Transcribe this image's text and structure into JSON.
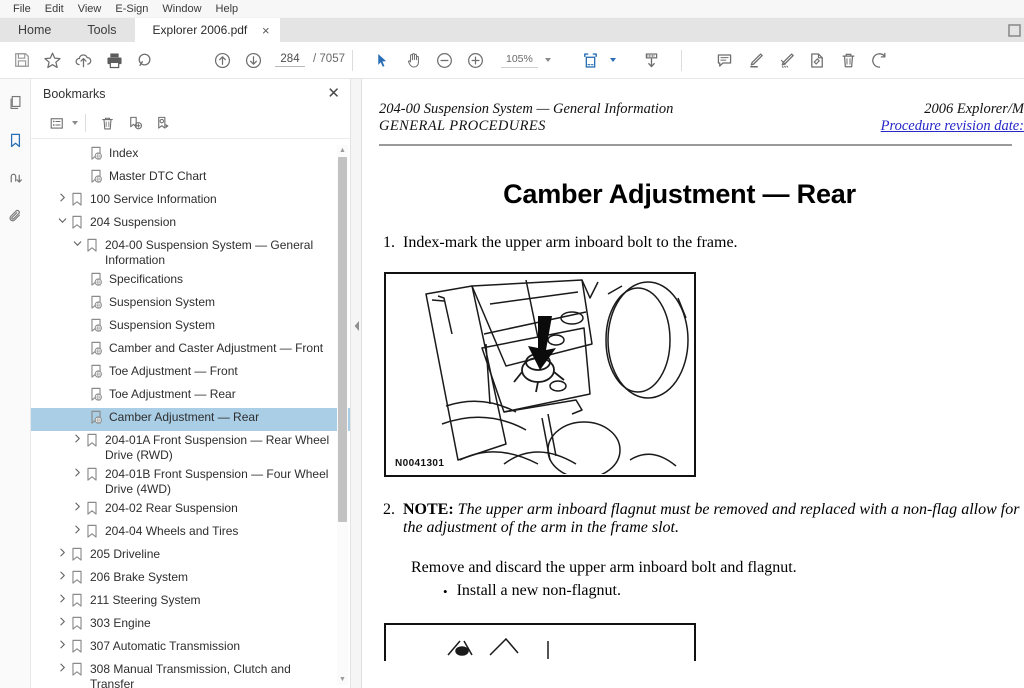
{
  "menubar": {
    "items": [
      "File",
      "Edit",
      "View",
      "E-Sign",
      "Window",
      "Help"
    ]
  },
  "tabbar": {
    "home_label": "Home",
    "tools_label": "Tools",
    "document_tab": "Explorer 2006.pdf",
    "close_glyph": "×"
  },
  "toolbar": {
    "save_icon": "save-icon",
    "star_icon": "star-icon",
    "cloud_upload_icon": "cloud-upload-icon",
    "print_icon": "print-icon",
    "search_icon": "search-icon",
    "prev_page_icon": "arrow-up-circle-icon",
    "next_page_icon": "arrow-down-circle-icon",
    "page_number": "284",
    "page_separator": "/",
    "page_total": "7057",
    "select_tool_icon": "cursor-arrow-icon",
    "hand_tool_icon": "hand-icon",
    "zoom_out_icon": "minus-circle-icon",
    "zoom_in_icon": "plus-circle-icon",
    "zoom_level": "105%",
    "fit_page_icon": "fit-page-icon",
    "scroll_mode_icon": "scroll-mode-icon",
    "comment_icon": "comment-icon",
    "highlight_icon": "highlight-pen-icon",
    "draw_icon": "draw-pen-icon",
    "stamp_icon": "stamp-icon",
    "delete_icon": "trash-icon",
    "undo_icon": "undo-icon"
  },
  "rail": {
    "items": [
      {
        "name": "page-thumbnails",
        "icon": "pages-icon",
        "active": false
      },
      {
        "name": "bookmarks",
        "icon": "bookmark-icon",
        "active": true
      },
      {
        "name": "signatures",
        "icon": "signature-arrow-icon",
        "active": false
      },
      {
        "name": "attachments",
        "icon": "paperclip-icon",
        "active": false
      }
    ]
  },
  "bookmarks_panel": {
    "title": "Bookmarks",
    "close_glyph": "✕",
    "tools": [
      {
        "name": "bookmark-options",
        "icon": "list-options-icon"
      },
      {
        "name": "delete-bookmark",
        "icon": "trash-icon"
      },
      {
        "name": "new-bookmark",
        "icon": "new-bookmark-icon"
      },
      {
        "name": "bookmark-destination",
        "icon": "bookmark-target-icon"
      }
    ],
    "items": [
      {
        "label": "Index",
        "depth": 2,
        "twisty": "",
        "icon": "web-bookmark-icon",
        "selected": false
      },
      {
        "label": "Master DTC Chart",
        "depth": 2,
        "twisty": "",
        "icon": "web-bookmark-icon",
        "selected": false
      },
      {
        "label": "100 Service Information",
        "depth": 0,
        "twisty": "collapsed",
        "icon": "bookmark-icon",
        "selected": false
      },
      {
        "label": "204 Suspension",
        "depth": 0,
        "twisty": "expanded",
        "icon": "bookmark-icon",
        "selected": false
      },
      {
        "label": "204-00 Suspension System — General Information",
        "depth": 1,
        "twisty": "expanded",
        "icon": "bookmark-icon",
        "selected": false
      },
      {
        "label": "Specifications",
        "depth": 2,
        "twisty": "",
        "icon": "web-bookmark-icon",
        "selected": false
      },
      {
        "label": "Suspension System",
        "depth": 2,
        "twisty": "",
        "icon": "web-bookmark-icon",
        "selected": false
      },
      {
        "label": "Suspension System",
        "depth": 2,
        "twisty": "",
        "icon": "web-bookmark-icon",
        "selected": false
      },
      {
        "label": "Camber and Caster Adjustment — Front",
        "depth": 2,
        "twisty": "",
        "icon": "web-bookmark-icon",
        "selected": false
      },
      {
        "label": "Toe Adjustment — Front",
        "depth": 2,
        "twisty": "",
        "icon": "web-bookmark-icon",
        "selected": false
      },
      {
        "label": "Toe Adjustment — Rear",
        "depth": 2,
        "twisty": "",
        "icon": "web-bookmark-icon",
        "selected": false
      },
      {
        "label": "Camber Adjustment — Rear",
        "depth": 2,
        "twisty": "",
        "icon": "web-bookmark-icon",
        "selected": true
      },
      {
        "label": "204-01A Front Suspension — Rear Wheel Drive (RWD)",
        "depth": 1,
        "twisty": "collapsed",
        "icon": "bookmark-icon",
        "selected": false
      },
      {
        "label": "204-01B Front Suspension — Four Wheel Drive (4WD)",
        "depth": 1,
        "twisty": "collapsed",
        "icon": "bookmark-icon",
        "selected": false
      },
      {
        "label": "204-02 Rear Suspension",
        "depth": 1,
        "twisty": "collapsed",
        "icon": "bookmark-icon",
        "selected": false
      },
      {
        "label": "204-04 Wheels and Tires",
        "depth": 1,
        "twisty": "collapsed",
        "icon": "bookmark-icon",
        "selected": false
      },
      {
        "label": "205 Driveline",
        "depth": 0,
        "twisty": "collapsed",
        "icon": "bookmark-icon",
        "selected": false
      },
      {
        "label": "206 Brake System",
        "depth": 0,
        "twisty": "collapsed",
        "icon": "bookmark-icon",
        "selected": false
      },
      {
        "label": "211 Steering System",
        "depth": 0,
        "twisty": "collapsed",
        "icon": "bookmark-icon",
        "selected": false
      },
      {
        "label": "303 Engine",
        "depth": 0,
        "twisty": "collapsed",
        "icon": "bookmark-icon",
        "selected": false
      },
      {
        "label": "307 Automatic Transmission",
        "depth": 0,
        "twisty": "collapsed",
        "icon": "bookmark-icon",
        "selected": false
      },
      {
        "label": "308 Manual Transmission, Clutch and Transfer",
        "depth": 0,
        "twisty": "collapsed",
        "icon": "bookmark-icon",
        "selected": false
      }
    ]
  },
  "document": {
    "header_left_line1": "204-00 Suspension System — General Information",
    "header_left_line2": "GENERAL PROCEDURES",
    "header_right_line1": "2006 Explorer/M",
    "header_right_line2": "Procedure revision date:",
    "title": "Camber Adjustment — Rear",
    "step1_num": "1.",
    "step1_text": "Index-mark the upper arm inboard bolt to the frame.",
    "figure1_code": "N0041301",
    "step2_num": "2.",
    "step2_note_label": "NOTE:",
    "step2_note_text": "The upper arm inboard flagnut must be removed and replaced with a non-flag",
    "step2_note_text2": "allow for the adjustment of the arm in the frame slot.",
    "step2_para": "Remove and discard the upper arm inboard bolt and flagnut.",
    "step2_bullet_dot": "•",
    "step2_bullet": "Install a new non-flagnut."
  },
  "colors": {
    "accent": "#2a6fb5",
    "selection": "#a9cee6",
    "link": "#2727c8",
    "tabbar_bg": "#e4e4e4"
  }
}
